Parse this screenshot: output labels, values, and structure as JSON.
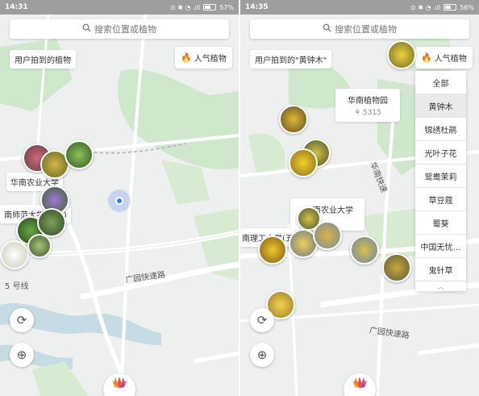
{
  "screen1": {
    "status": {
      "time": "14:31",
      "icons": "⊙ ✱ ◔ .ıll",
      "battery": "57%"
    },
    "search_placeholder": "搜索位置或植物",
    "chip": "用户拍到的植物",
    "popular_label": "人气植物",
    "labels": {
      "poi": "华南农业大学",
      "normal_univ": "南师范大学(…区)",
      "road": "广园快速路",
      "line5": "5 号线"
    }
  },
  "screen2": {
    "status": {
      "time": "14:35",
      "icons": "⊙ ✱ ◔ .ıll",
      "battery": "56%"
    },
    "search_placeholder": "搜索位置或植物",
    "chip": "用户拍到的\"黄钟木\"",
    "popular_label": "人气植物",
    "dropdown": [
      "全部",
      "黄钟木",
      "锦绣杜鹃",
      "光叶子花",
      "鸳鸯茉莉",
      "草豆蔻",
      "蜀葵",
      "中国无忧…",
      "鬼针草"
    ],
    "dropdown_selected": 1,
    "poi_card": {
      "title": "华南植物园",
      "count": "5315"
    },
    "labels": {
      "agri": "南农业大学",
      "agri_sub": "9",
      "tech": "南理工大学(五",
      "road1": "华南快速",
      "road2": "广园快速路"
    }
  },
  "icons": {
    "search": "search-icon",
    "flame": "flame-icon",
    "refresh": "refresh-icon",
    "locate": "locate-icon",
    "logo": "lotus-logo-icon"
  },
  "colors": {
    "accent": "#e04a3a",
    "location": "#3b7be5",
    "map_bg": "#eef0ef",
    "park": "#cfe8cb",
    "water": "#c6dbe3"
  }
}
